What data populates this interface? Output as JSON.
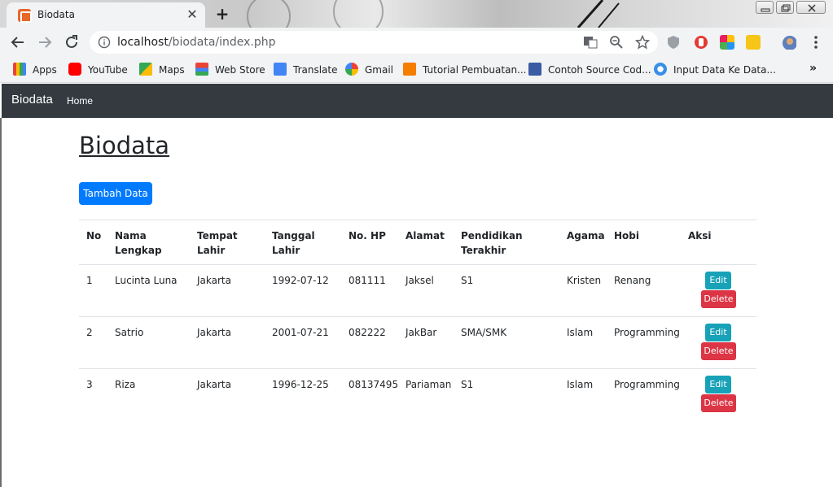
{
  "browser": {
    "tab_title": "Biodata",
    "url_host": "localhost",
    "url_path": "/biodata/index.php"
  },
  "bookmarks": [
    {
      "label": "Apps",
      "icon": "apps-grid-icon",
      "color": "#4285f4"
    },
    {
      "label": "YouTube",
      "icon": "youtube-icon",
      "color": "#ff0000"
    },
    {
      "label": "Maps",
      "icon": "maps-icon",
      "color": "#34a853"
    },
    {
      "label": "Web Store",
      "icon": "web-store-icon",
      "color": "#fbbc05"
    },
    {
      "label": "Translate",
      "icon": "translate-icon",
      "color": "#4285f4"
    },
    {
      "label": "Gmail",
      "icon": "google-icon",
      "color": "#ea4335"
    },
    {
      "label": "Tutorial Pembuatan...",
      "icon": "blogger-icon",
      "color": "#f57d00"
    },
    {
      "label": "Contoh Source Cod...",
      "icon": "kmw-icon",
      "color": "#3b5ba5"
    },
    {
      "label": "Input Data Ke Data...",
      "icon": "link-icon",
      "color": "#3a8ee6"
    }
  ],
  "navbar": {
    "brand": "Biodata",
    "home": "Home"
  },
  "page": {
    "title": "Biodata",
    "add_button": "Tambah Data"
  },
  "table": {
    "headers": {
      "no": "No",
      "nama_1": "Nama",
      "nama_2": "Lengkap",
      "tempat_1": "Tempat",
      "tempat_2": "Lahir",
      "tanggal_1": "Tanggal",
      "tanggal_2": "Lahir",
      "hp": "No. HP",
      "alamat": "Alamat",
      "pendidikan_1": "Pendidikan",
      "pendidikan_2": "Terakhir",
      "agama": "Agama",
      "hobi": "Hobi",
      "aksi": "Aksi"
    },
    "rows": [
      {
        "no": "1",
        "nama": "Lucinta Luna",
        "tempat": "Jakarta",
        "tanggal": "1992-07-12",
        "hp": "081111",
        "alamat": "Jaksel",
        "pendidikan": "S1",
        "agama": "Kristen",
        "hobi": "Renang",
        "edit": "Edit",
        "delete": "Delete"
      },
      {
        "no": "2",
        "nama": "Satrio",
        "tempat": "Jakarta",
        "tanggal": "2001-07-21",
        "hp": "082222",
        "alamat": "JakBar",
        "pendidikan": "SMA/SMK",
        "agama": "Islam",
        "hobi": "Programming",
        "edit": "Edit",
        "delete": "Delete"
      },
      {
        "no": "3",
        "nama": "Riza",
        "tempat": "Jakarta",
        "tanggal": "1996-12-25",
        "hp": "08137495",
        "alamat": "Pariaman",
        "pendidikan": "S1",
        "agama": "Islam",
        "hobi": "Programming",
        "edit": "Edit",
        "delete": "Delete"
      }
    ]
  },
  "colors": {
    "navbar_bg": "#343a40",
    "primary": "#007bff",
    "info": "#17a2b8",
    "danger": "#dc3545"
  }
}
